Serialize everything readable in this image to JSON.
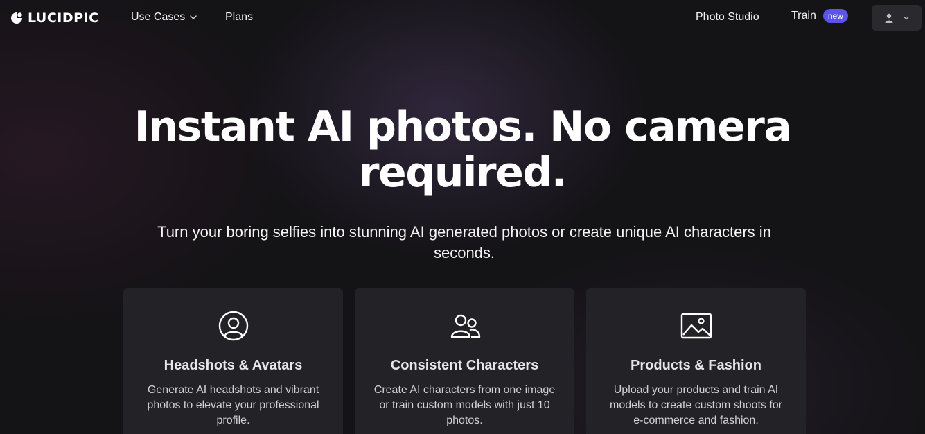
{
  "nav": {
    "logo_text": "LUCIDPIC",
    "use_cases_label": "Use Cases",
    "plans_label": "Plans",
    "photo_studio_label": "Photo Studio",
    "train_label": "Train",
    "train_badge": "new",
    "icons": {
      "logo": "lucidpic-logo-icon",
      "use_cases": "chevron-down-icon",
      "user": "user-icon",
      "user_menu": "chevron-down-icon"
    }
  },
  "hero": {
    "title_line1": "Instant AI photos. No camera",
    "title_line2": "required.",
    "subtitle": "Turn your boring selfies into stunning AI generated photos or create unique AI characters in seconds."
  },
  "cards": [
    {
      "icon": "user-circle-icon",
      "title": "Headshots & Avatars",
      "description": "Generate AI headshots and vibrant photos to elevate your professional profile."
    },
    {
      "icon": "users-icon",
      "title": "Consistent Characters",
      "description": "Create AI characters from one image or train custom models with just 10 photos."
    },
    {
      "icon": "image-icon",
      "title": "Products & Fashion",
      "description": "Upload your products and train AI models to create custom shoots for e-commerce and fashion."
    }
  ],
  "colors": {
    "background": "#141316",
    "card_background": "#232226",
    "badge": "#5b54e6",
    "user_button": "#2a292d"
  }
}
